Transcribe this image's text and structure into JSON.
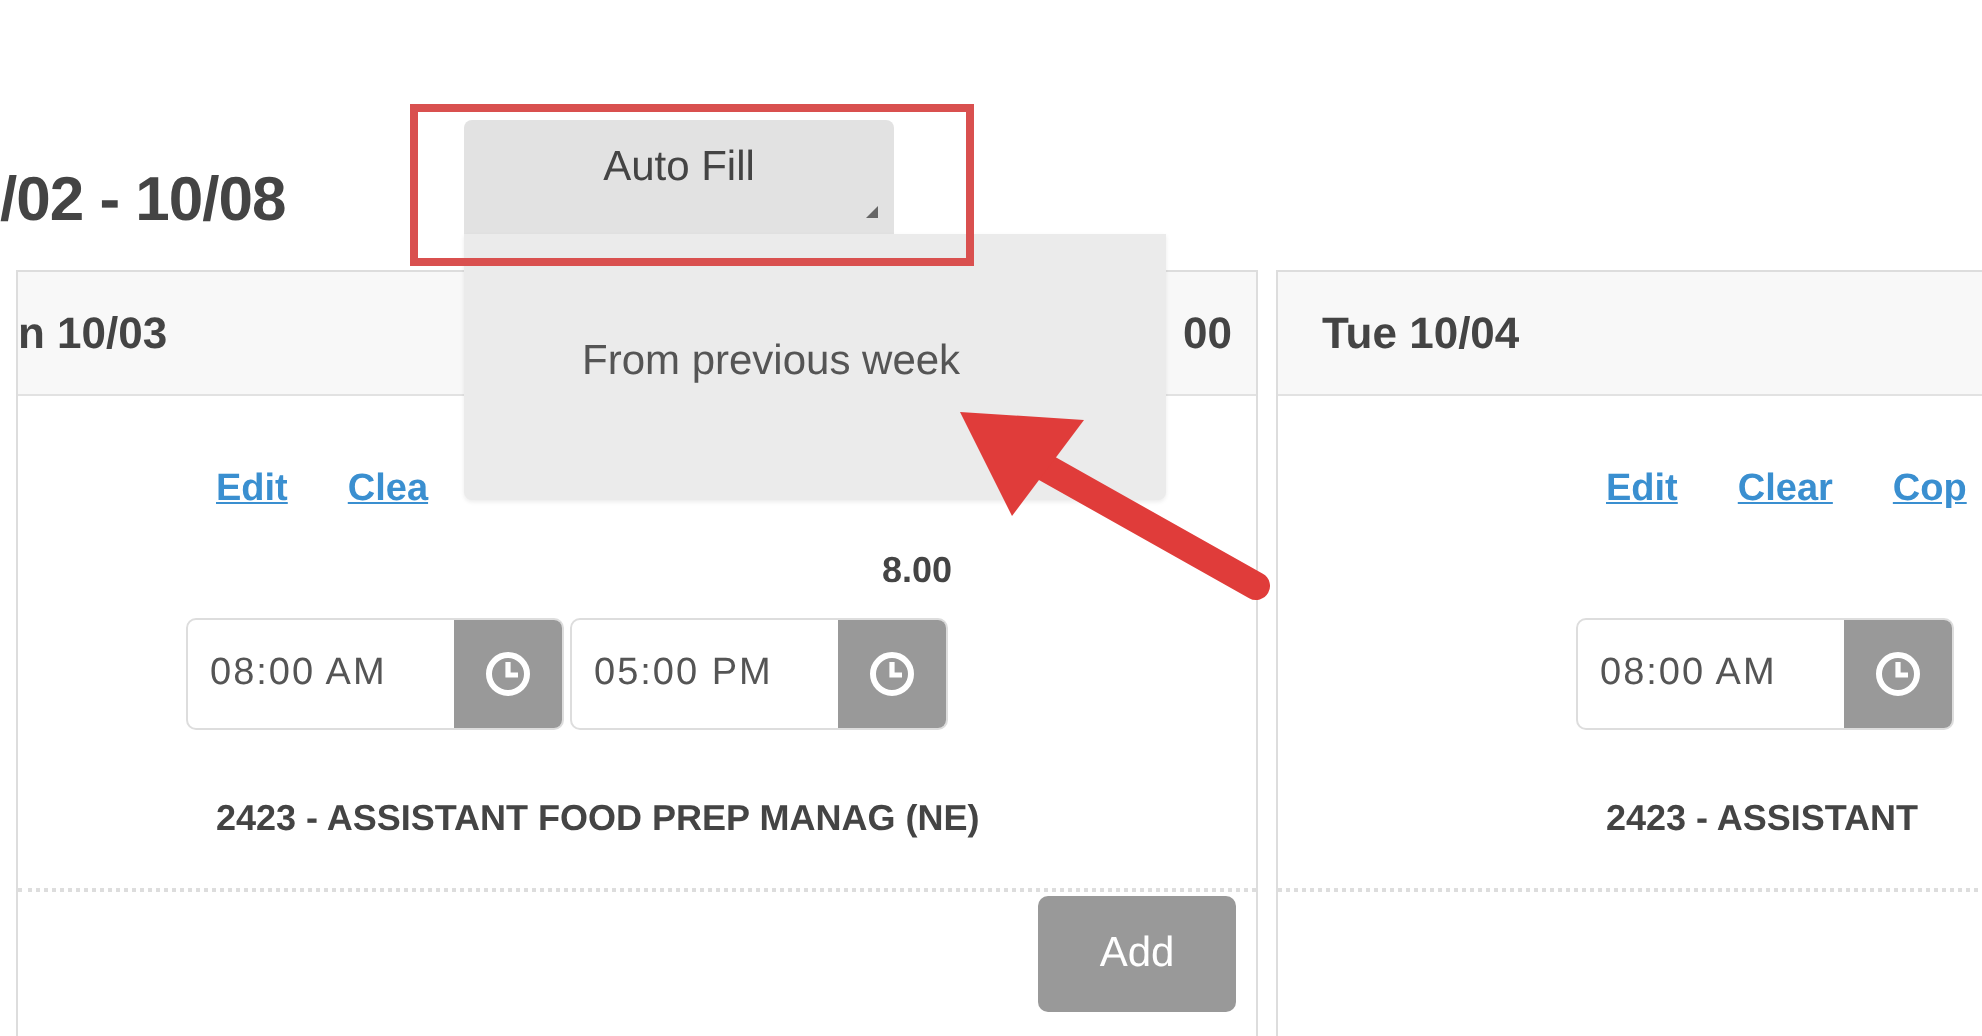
{
  "week_range": "/02 - 10/08",
  "auto_fill": {
    "label": "Auto Fill",
    "expanded": true,
    "menu_items": [
      "From previous week"
    ]
  },
  "days": [
    {
      "header": "n 10/03",
      "total": "00",
      "links": [
        "Edit",
        "Clea"
      ],
      "hours": "8.00",
      "times": [
        "08:00 AM",
        "05:00 PM"
      ],
      "job": "2423 - ASSISTANT FOOD PREP MANAG (NE)",
      "add_label": "Add"
    },
    {
      "header": "Tue 10/04",
      "links": [
        "Edit",
        "Clear",
        "Cop"
      ],
      "times": [
        "08:00 AM"
      ],
      "job": "2423 - ASSISTANT"
    }
  ],
  "annotations": {
    "highlight_frame": true,
    "arrow": true
  }
}
